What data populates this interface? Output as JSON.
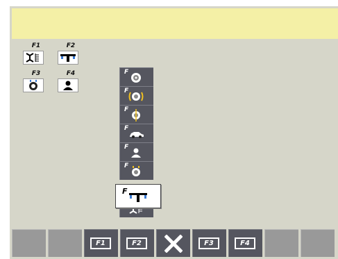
{
  "quick_functions": [
    {
      "key": "F1",
      "icon": "wheel-balancer-dimensions-icon"
    },
    {
      "key": "F2",
      "icon": "alu-weights-icon"
    },
    {
      "key": "F3",
      "icon": "tyre-valve-icon"
    },
    {
      "key": "F4",
      "icon": "operator-icon"
    }
  ],
  "menu": {
    "items": [
      {
        "key": "F",
        "icon": "wheel-icon"
      },
      {
        "key": "F",
        "icon": "wheel-optimization-icon"
      },
      {
        "key": "F",
        "icon": "wheel-centering-icon"
      },
      {
        "key": "F",
        "icon": "car-icon"
      },
      {
        "key": "F",
        "icon": "user-icon"
      },
      {
        "key": "F",
        "icon": "tyre-valve-icon"
      },
      {
        "key": "F",
        "icon": "alu-weights-icon",
        "selected": true
      },
      {
        "key": "F",
        "icon": "wheel-balancer-dimensions-icon"
      }
    ]
  },
  "softkeys": [
    {
      "label": "",
      "lit": false
    },
    {
      "label": "",
      "lit": false
    },
    {
      "label": "F1",
      "lit": true
    },
    {
      "label": "F2",
      "lit": true
    },
    {
      "label": "",
      "icon": "close-icon",
      "lit": true
    },
    {
      "label": "F3",
      "lit": true
    },
    {
      "label": "F4",
      "lit": true
    },
    {
      "label": "",
      "lit": false
    },
    {
      "label": "",
      "lit": false
    }
  ],
  "colors": {
    "background": "#d6d6c9",
    "message_bar": "#f4f0a6",
    "menu_item": "#55565f",
    "softkey_inactive": "#999999"
  }
}
